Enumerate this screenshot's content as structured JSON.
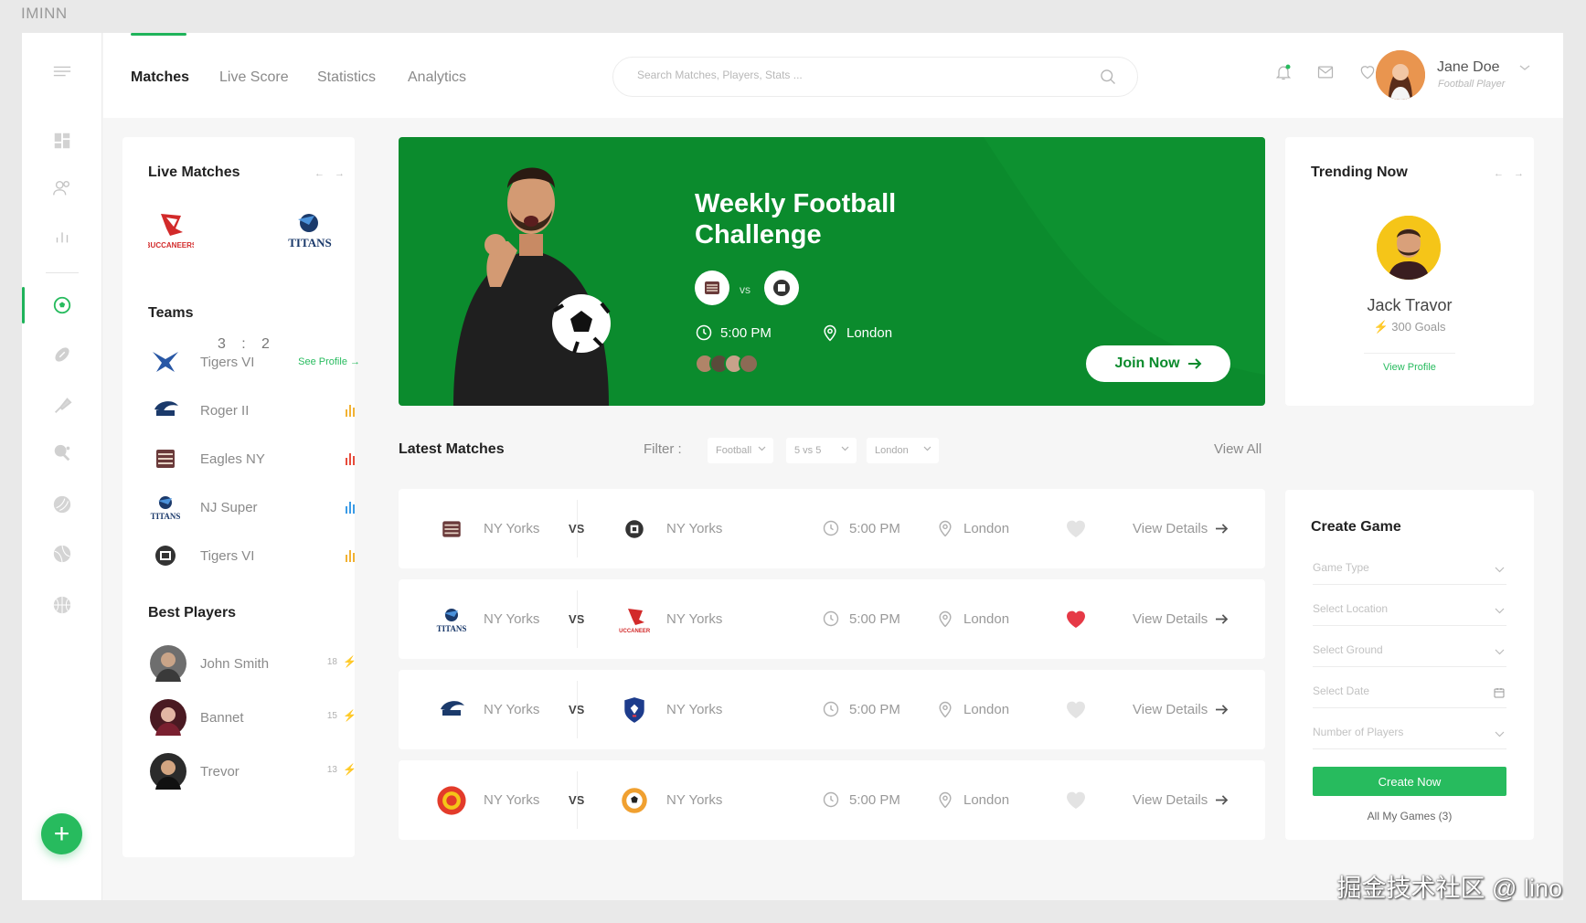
{
  "brand": "IMINN",
  "watermark": "掘金技术社区 @ lino",
  "colors": {
    "accent": "#27bb5e",
    "hero_bg": "#0b8b2d",
    "heart_active": "#e63946"
  },
  "nav": {
    "tabs": [
      {
        "label": "Matches",
        "active": true
      },
      {
        "label": "Live Score"
      },
      {
        "label": "Statistics"
      },
      {
        "label": "Analytics"
      }
    ]
  },
  "search": {
    "placeholder": "Search Matches, Players, Stats ..."
  },
  "user": {
    "name": "Jane Doe",
    "role": "Football Player"
  },
  "sidebar": {
    "icons": [
      "menu-icon",
      "dashboard-icon",
      "users-icon",
      "chart-icon",
      "soccer-ball-icon",
      "football-icon",
      "badminton-icon",
      "table-tennis-icon",
      "baseball-icon",
      "tennis-icon",
      "basketball-icon"
    ],
    "active": "soccer-ball-icon",
    "fab": "+"
  },
  "live_matches": {
    "title": "Live Matches",
    "home": "Buccaneers",
    "away": "Titans",
    "home_score": "3",
    "separator": ":",
    "away_score": "2"
  },
  "teams": {
    "title": "Teams",
    "items": [
      {
        "name": "Tigers VI",
        "action": "See Profile"
      },
      {
        "name": "Roger II",
        "bar_color": "#f2b233"
      },
      {
        "name": "Eagles NY",
        "bar_color": "#e74c3c"
      },
      {
        "name": "NJ Super",
        "bar_color": "#3b9be6"
      },
      {
        "name": "Tigers VI",
        "bar_color": "#f2b233"
      }
    ]
  },
  "best_players": {
    "title": "Best Players",
    "items": [
      {
        "name": "John Smith",
        "number": "18",
        "bolt_color": "#27bb5e"
      },
      {
        "name": "Bannet",
        "number": "15",
        "bolt_color": "#f2b233"
      },
      {
        "name": "Trevor",
        "number": "13",
        "bolt_color": "#e74c3c"
      }
    ]
  },
  "hero": {
    "title_line1": "Weekly Football",
    "title_line2": "Challenge",
    "vs": "vs",
    "time": "5:00 PM",
    "location": "London",
    "cta": "Join Now"
  },
  "latest_matches": {
    "title": "Latest Matches",
    "filter_label": "Filter :",
    "filters": [
      "Football",
      "5 vs 5",
      "London"
    ],
    "view_all": "View All",
    "rows": [
      {
        "home": "NY Yorks",
        "vs": "VS",
        "away": "NY Yorks",
        "time": "5:00 PM",
        "location": "London",
        "liked": false,
        "details": "View Details"
      },
      {
        "home": "NY Yorks",
        "vs": "VS",
        "away": "NY Yorks",
        "time": "5:00 PM",
        "location": "London",
        "liked": true,
        "details": "View Details"
      },
      {
        "home": "NY Yorks",
        "vs": "VS",
        "away": "NY Yorks",
        "time": "5:00 PM",
        "location": "London",
        "liked": false,
        "details": "View Details"
      },
      {
        "home": "NY Yorks",
        "vs": "VS",
        "away": "NY Yorks",
        "time": "5:00 PM",
        "location": "London",
        "liked": false,
        "details": "View Details"
      }
    ]
  },
  "trending": {
    "title": "Trending Now",
    "name": "Jack Travor",
    "goals": "300 Goals",
    "link": "View Profile"
  },
  "create_game": {
    "title": "Create Game",
    "fields": [
      "Game Type",
      "Select Location",
      "Select Ground",
      "Select Date",
      "Number of Players"
    ],
    "button": "Create Now",
    "link": "All My Games (3)"
  }
}
